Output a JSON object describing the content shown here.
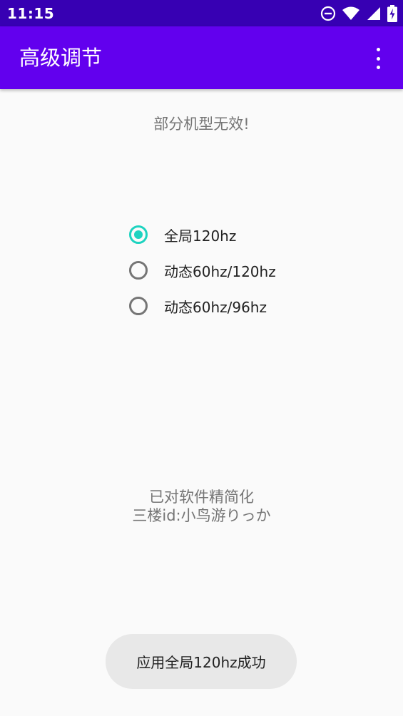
{
  "status_bar": {
    "time": "11:15",
    "icons": [
      "do-not-disturb-icon",
      "wifi-icon",
      "signal-icon",
      "battery-charging-icon"
    ]
  },
  "app_bar": {
    "title": "高级调节",
    "menu_icon": "more-vert-icon"
  },
  "main": {
    "warning": "部分机型无效!",
    "options": [
      {
        "label": "全局120hz",
        "checked": true
      },
      {
        "label": "动态60hz/120hz",
        "checked": false
      },
      {
        "label": "动态60hz/96hz",
        "checked": false
      }
    ],
    "credits_line1": "已对软件精简化",
    "credits_line2": "三楼id:小鸟游りっか"
  },
  "toast": {
    "message": "应用全局120hz成功"
  },
  "colors": {
    "status_bar": "#3700b3",
    "app_bar": "#6200ee",
    "accent": "#1dd3c0",
    "background": "#fafafa"
  }
}
